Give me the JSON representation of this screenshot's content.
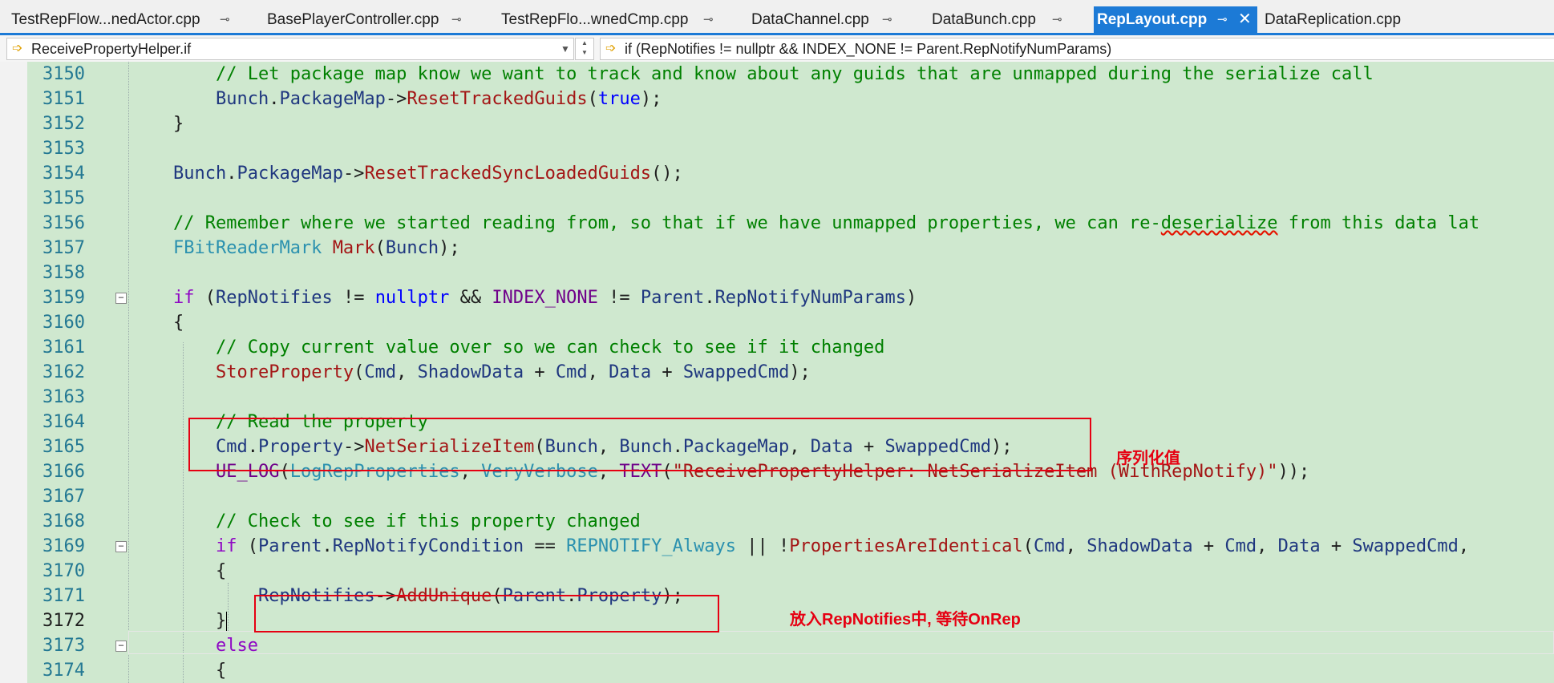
{
  "tabs": [
    {
      "label": "TestRepFlow...nedActor.cpp",
      "pinned": true
    },
    {
      "label": "BasePlayerController.cpp",
      "pinned": true
    },
    {
      "label": "TestRepFlo...wnedCmp.cpp",
      "pinned": true
    },
    {
      "label": "DataChannel.cpp",
      "pinned": true
    },
    {
      "label": "DataBunch.cpp",
      "pinned": true
    },
    {
      "label": "RepLayout.cpp",
      "pinned": true,
      "active": true
    },
    {
      "label": "DataReplication.cpp",
      "pinned": false
    }
  ],
  "nav": {
    "scope": "ReceivePropertyHelper.if",
    "member": "if (RepNotifies != nullptr && INDEX_NONE != Parent.RepNotifyNumParams)"
  },
  "editor": {
    "lines": [
      {
        "n": "3150",
        "text": "    // Let package map know we want to track and know about any guids that are unmapped during the serialize call"
      },
      {
        "n": "3151",
        "text": "    Bunch.PackageMap->ResetTrackedGuids(true);"
      },
      {
        "n": "3152",
        "text": "}"
      },
      {
        "n": "3153",
        "text": ""
      },
      {
        "n": "3154",
        "text": "Bunch.PackageMap->ResetTrackedSyncLoadedGuids();"
      },
      {
        "n": "3155",
        "text": ""
      },
      {
        "n": "3156",
        "text": "// Remember where we started reading from, so that if we have unmapped properties, we can re-deserialize from this data lat"
      },
      {
        "n": "3157",
        "text": "FBitReaderMark Mark(Bunch);"
      },
      {
        "n": "3158",
        "text": ""
      },
      {
        "n": "3159",
        "text": "if (RepNotifies != nullptr && INDEX_NONE != Parent.RepNotifyNumParams)"
      },
      {
        "n": "3160",
        "text": "{"
      },
      {
        "n": "3161",
        "text": "    // Copy current value over so we can check to see if it changed"
      },
      {
        "n": "3162",
        "text": "    StoreProperty(Cmd, ShadowData + Cmd, Data + SwappedCmd);"
      },
      {
        "n": "3163",
        "text": ""
      },
      {
        "n": "3164",
        "text": "    // Read the property"
      },
      {
        "n": "3165",
        "text": "    Cmd.Property->NetSerializeItem(Bunch, Bunch.PackageMap, Data + SwappedCmd);"
      },
      {
        "n": "3166",
        "text": "    UE_LOG(LogRepProperties, VeryVerbose, TEXT(\"ReceivePropertyHelper: NetSerializeItem (WithRepNotify)\"));"
      },
      {
        "n": "3167",
        "text": ""
      },
      {
        "n": "3168",
        "text": "    // Check to see if this property changed"
      },
      {
        "n": "3169",
        "text": "    if (Parent.RepNotifyCondition == REPNOTIFY_Always || !PropertiesAreIdentical(Cmd, ShadowData + Cmd, Data + SwappedCmd,"
      },
      {
        "n": "3170",
        "text": "    {"
      },
      {
        "n": "3171",
        "text": "        RepNotifies->AddUnique(Parent.Property);"
      },
      {
        "n": "3172",
        "text": "    }"
      },
      {
        "n": "3173",
        "text": "    else"
      },
      {
        "n": "3174",
        "text": "    {"
      }
    ],
    "current_line": "3172"
  },
  "annotations": {
    "serialize_label": "序列化值",
    "repnotify_label": "放入RepNotifies中, 等待OnRep"
  }
}
